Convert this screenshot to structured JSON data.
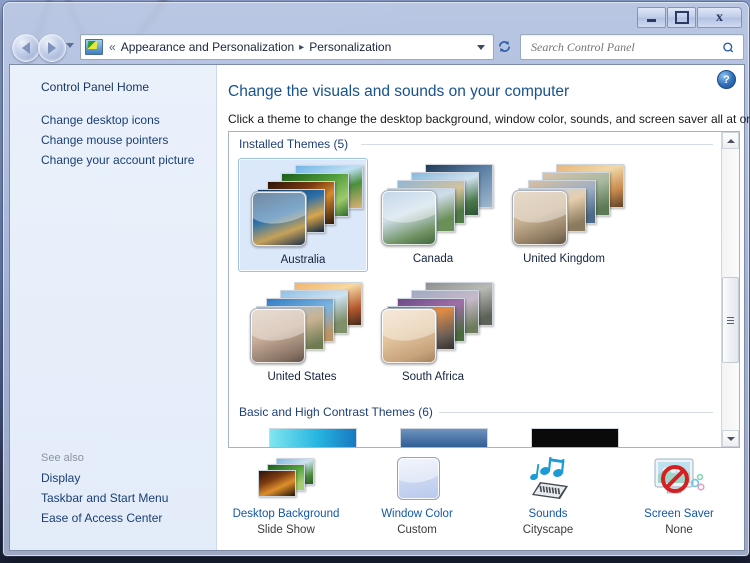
{
  "window": {
    "controls": {
      "minimize": "Minimize",
      "maximize": "Maximize",
      "close": "Close"
    }
  },
  "nav": {
    "back": "Back",
    "forward": "Forward",
    "recent_pages": "Recent Pages",
    "address_icon": "control-panel-icon",
    "chevrons": "«",
    "breadcrumbs": [
      {
        "label": "Appearance and Personalization"
      },
      {
        "label": "Personalization"
      }
    ],
    "crumb_separator": "▸",
    "refresh": "↻",
    "search": {
      "placeholder": "Search Control Panel",
      "value": ""
    }
  },
  "sidebar": {
    "home": "Control Panel Home",
    "items": [
      {
        "label": "Change desktop icons"
      },
      {
        "label": "Change mouse pointers"
      },
      {
        "label": "Change your account picture"
      }
    ],
    "see_also_title": "See also",
    "see_also": [
      {
        "label": "Display"
      },
      {
        "label": "Taskbar and Start Menu"
      },
      {
        "label": "Ease of Access Center"
      }
    ]
  },
  "main": {
    "help": "?",
    "title": "Change the visuals and sounds on your computer",
    "subtitle": "Click a theme to change the desktop background, window color, sounds, and screen saver all at once.",
    "groups": [
      {
        "id": "installed",
        "label": "Installed Themes (5)"
      },
      {
        "id": "basic",
        "label": "Basic and High Contrast Themes (6)"
      }
    ],
    "themes": [
      {
        "label": "Australia",
        "selected": true
      },
      {
        "label": "Canada",
        "selected": false
      },
      {
        "label": "United Kingdom",
        "selected": false
      },
      {
        "label": "United States",
        "selected": false
      },
      {
        "label": "South Africa",
        "selected": false
      }
    ],
    "scrollbar": {
      "up": "▲",
      "down": "▼"
    }
  },
  "settings": [
    {
      "icon": "desktop-background-icon",
      "title": "Desktop Background",
      "value": "Slide Show"
    },
    {
      "icon": "window-color-icon",
      "title": "Window Color",
      "value": "Custom"
    },
    {
      "icon": "sounds-icon",
      "title": "Sounds",
      "value": "Cityscape"
    },
    {
      "icon": "screen-saver-icon",
      "title": "Screen Saver",
      "value": "None"
    }
  ],
  "colors": {
    "accent_link": "#1457a8",
    "heading": "#17528f",
    "selection": "#dbe8fa",
    "selection_border": "#9cc0e8"
  }
}
